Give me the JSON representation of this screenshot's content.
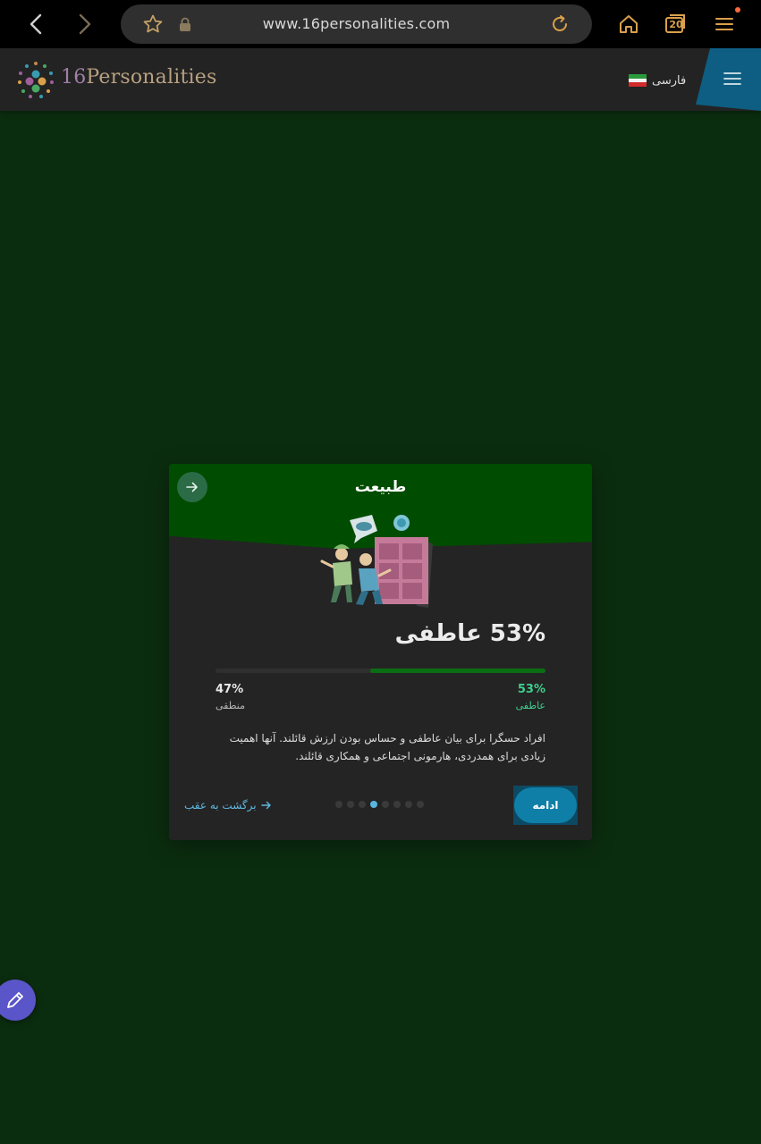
{
  "browser": {
    "url": "www.16personalities.com",
    "tab_count": "20"
  },
  "header": {
    "logo_number": "16",
    "logo_word": "Personalities",
    "language_label": "فارسی"
  },
  "card": {
    "title": "طبیعت",
    "headline": "53% عاطفی",
    "trait_right": {
      "percent": "53%",
      "label": "عاطفی",
      "value": 53
    },
    "trait_left": {
      "percent": "47%",
      "label": "منطقی",
      "value": 47
    },
    "description": "افراد حسگرا برای بیان عاطفی و حساس بودن ارزش قائلند. آنها اهمیت زیادی برای همدردی، هارمونی اجتماعی و همکاری قائلند.",
    "back_label": "برگشت به عقب",
    "continue_label": "ادامه",
    "steps": {
      "total": 8,
      "active_index": 3
    }
  },
  "colors": {
    "page_background": "#0b2d0f",
    "card_accent": "#004c00",
    "trait_green": "#3ecf8e",
    "action_blue": "#0f7fa8",
    "link_blue": "#5fb8e0"
  },
  "icons": [
    "back-arrow-icon",
    "forward-arrow-icon",
    "star-icon",
    "lock-icon",
    "reload-icon",
    "home-icon",
    "tabs-icon",
    "menu-icon",
    "iran-flag-icon",
    "hamburger-icon",
    "arrow-right-icon",
    "pencil-icon"
  ]
}
